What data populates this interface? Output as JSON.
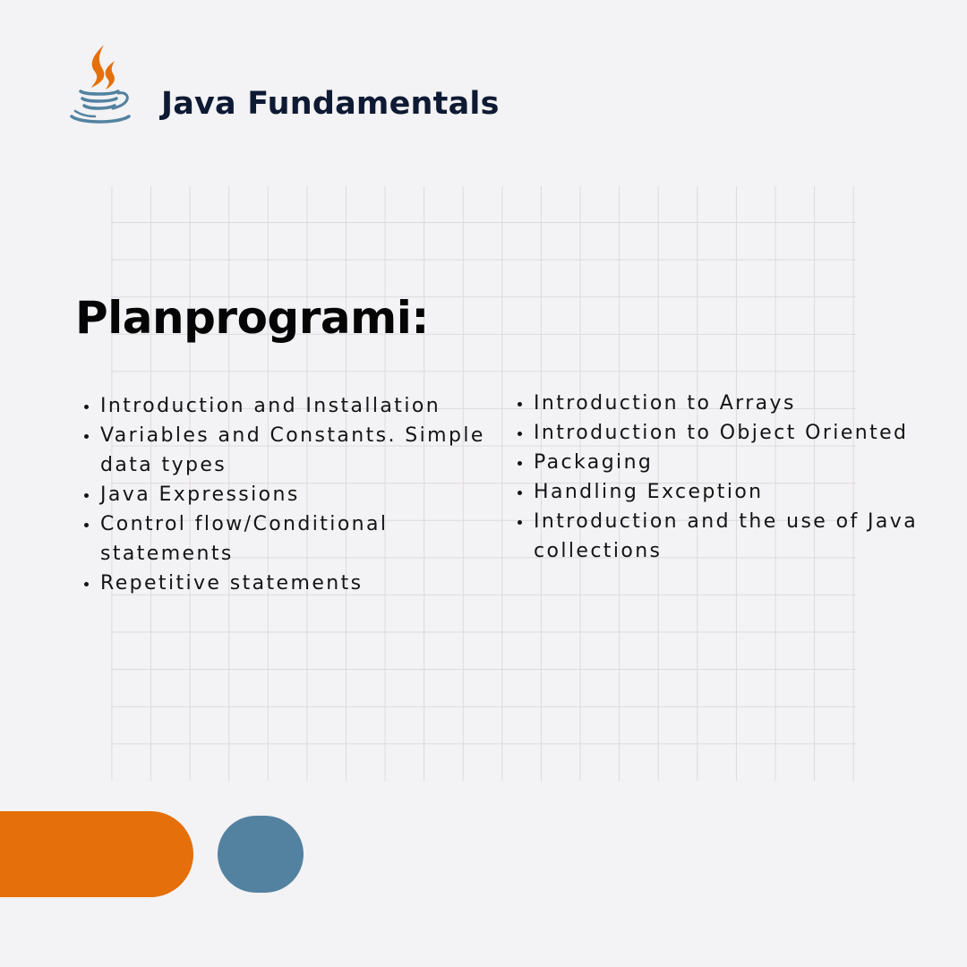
{
  "header": {
    "title": "Java Fundamentals",
    "logo_icon": "java-coffee-cup-icon"
  },
  "section": {
    "title": "Planprogrami:"
  },
  "topics": {
    "left": [
      {
        "label": "Introduction and Installation"
      },
      {
        "label": "Variables and Constants. Simple data types"
      },
      {
        "label": "Java Expressions"
      },
      {
        "label": "Control flow/Conditional statements"
      },
      {
        "label": "Repetitive statements"
      }
    ],
    "right": [
      {
        "label": "Introduction to Arrays"
      },
      {
        "label": "Introduction to Object Oriented"
      },
      {
        "label": "Packaging"
      },
      {
        "label": "Handling Exception"
      },
      {
        "label": "Introduction and the use of Java collections"
      }
    ]
  },
  "colors": {
    "background": "#f3f2f4",
    "title_navy": "#0e1a33",
    "java_orange": "#e56f0a",
    "java_blue": "#5382a1"
  }
}
